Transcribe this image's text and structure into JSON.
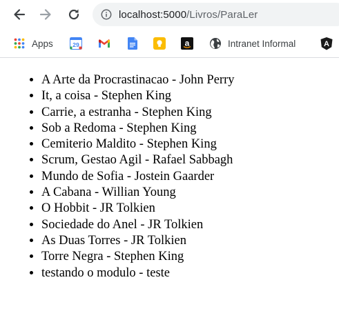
{
  "browser": {
    "url_host": "localhost:5000",
    "url_path": "/Livros/ParaLer"
  },
  "bookmarks": [
    {
      "label": "Apps",
      "icon": "apps-grid-icon"
    },
    {
      "label": "",
      "icon": "calendar-icon",
      "icon_text": "29"
    },
    {
      "label": "",
      "icon": "gmail-icon"
    },
    {
      "label": "",
      "icon": "docs-icon"
    },
    {
      "label": "",
      "icon": "keep-icon"
    },
    {
      "label": "",
      "icon": "amazon-icon",
      "icon_text": "a"
    },
    {
      "label": "Intranet Informal",
      "icon": "globe-icon"
    },
    {
      "label": "",
      "icon": "angular-icon",
      "icon_text": "A"
    }
  ],
  "books": [
    "A Arte da Procrastinacao - John Perry",
    "It, a coisa - Stephen King",
    "Carrie, a estranha - Stephen King",
    "Sob a Redoma - Stephen King",
    "Cemiterio Maldito - Stephen King",
    "Scrum, Gestao Agil - Rafael Sabbagh",
    "Mundo de Sofia - Jostein Gaarder",
    "A Cabana - Willian Young",
    "O Hobbit - JR Tolkien",
    "Sociedade do Anel - JR Tolkien",
    "As Duas Torres - JR Tolkien",
    "Torre Negra - Stephen King",
    "testando o modulo - teste"
  ]
}
